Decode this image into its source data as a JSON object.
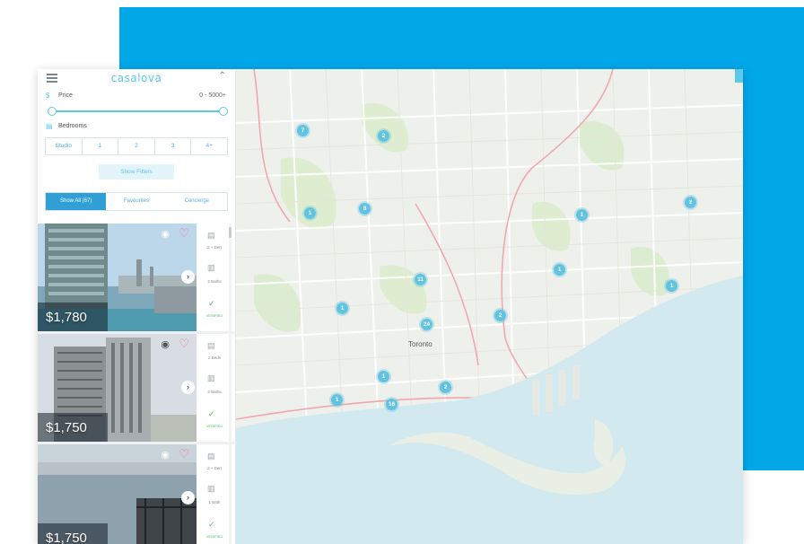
{
  "app": {
    "logo_text": "casalova"
  },
  "filters": {
    "price_label": "Price",
    "price_range": "0 - 5000+",
    "bedrooms_label": "Bedrooms",
    "bedroom_options": [
      "Studio",
      "1",
      "2",
      "3",
      "4+"
    ],
    "show_filters_label": "Show Filters"
  },
  "tabs": [
    "Show All (67)",
    "Favourites",
    "Concierge"
  ],
  "listings": [
    {
      "price": "$1,780",
      "beds": "2 + Den",
      "baths": "2 Baths",
      "verified": "VERIFIED"
    },
    {
      "price": "$1,750",
      "beds": "2 Beds",
      "baths": "2 Baths",
      "verified": "VERIFIED"
    },
    {
      "price": "$1,750",
      "beds": "2 + Den",
      "baths": "1 Bath",
      "verified": "VERIFIED"
    }
  ],
  "map": {
    "city_label": "Toronto",
    "clusters": [
      "7",
      "2",
      "1",
      "8",
      "1",
      "11",
      "1",
      "24",
      "2",
      "1",
      "1",
      "16",
      "2",
      "1",
      "1",
      "2",
      "1"
    ]
  },
  "colors": {
    "accent": "#02a7e8",
    "cluster": "#61c3e0",
    "heart": "#ff6f86",
    "verified": "#4cbb5b"
  }
}
